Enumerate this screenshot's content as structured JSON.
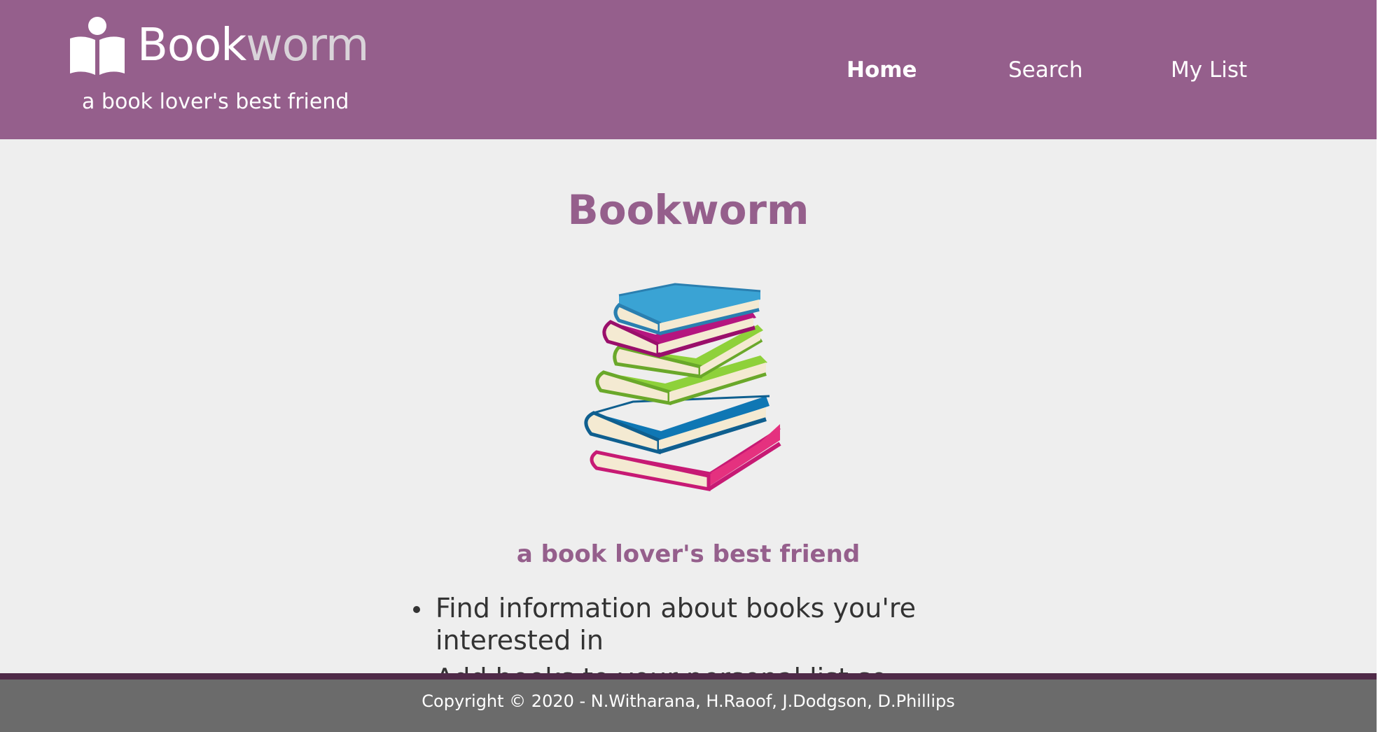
{
  "app": {
    "brand_prefix": "Book",
    "brand_suffix": "worm",
    "tagline": "a book lover's best friend",
    "logo_icon": "reader-book-icon",
    "colors": {
      "primary": "#955f8c",
      "brand_suffix": "#d9d3d9",
      "page_bg": "#eeeeee",
      "footer": "#6b6b6b",
      "footer_stripe": "#4f2a48"
    }
  },
  "nav": {
    "items": [
      {
        "label": "Home",
        "active": true
      },
      {
        "label": "Search",
        "active": false
      },
      {
        "label": "My List",
        "active": false
      }
    ]
  },
  "main": {
    "title": "Bookworm",
    "illustration": "stack-of-books",
    "subtitle": "a book lover's best friend",
    "features": [
      "Find information about books you're interested in",
      "Add books to your personal list so that"
    ]
  },
  "footer": {
    "copyright": "Copyright © 2020 - N.Witharana, H.Raoof, J.Dodgson, D.Phillips"
  }
}
